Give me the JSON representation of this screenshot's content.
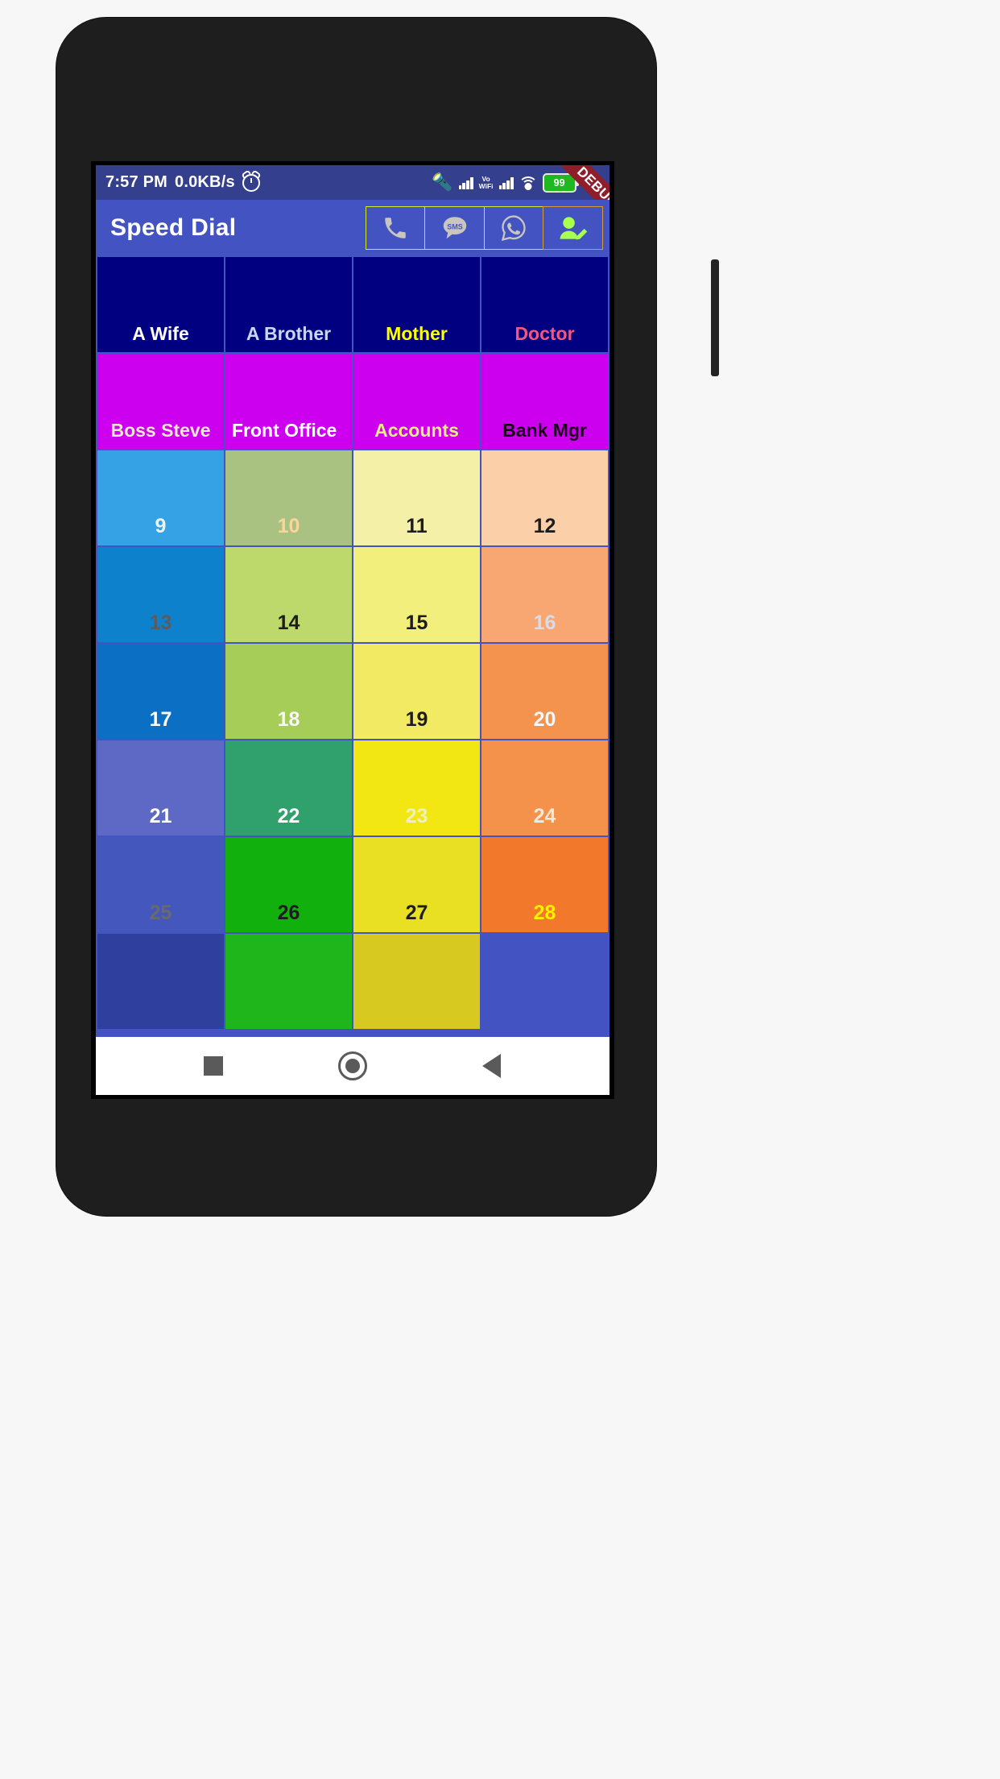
{
  "status_bar": {
    "time": "7:57 PM",
    "network_speed": "0.0KB/s",
    "alarm_icon": "alarm-clock-icon",
    "bluetooth_icon": "bluetooth-icon",
    "signal_icon_1": "cellular-signal-icon",
    "volte_line1": "Vo",
    "volte_line2": "WiFi",
    "signal_icon_2": "cellular-signal-icon",
    "wifi_icon": "wifi-icon",
    "battery_percent": "99",
    "charging_icon": "charging-bolt-icon",
    "background": "#343f8d"
  },
  "debug_ribbon": {
    "label": "DEBUG",
    "color": "#8f1d2a"
  },
  "app_bar": {
    "title": "Speed Dial",
    "background": "#4354c2",
    "actions": [
      {
        "name": "call-button",
        "icon": "phone-icon",
        "border": "#d7e830"
      },
      {
        "name": "sms-button",
        "icon": "sms-icon",
        "border": "#d7e830",
        "glyph_text": "SMS"
      },
      {
        "name": "whatsapp-button",
        "icon": "whatsapp-icon",
        "border": "#d7e830"
      },
      {
        "name": "add-contact-button",
        "icon": "add-contact-icon",
        "border": "#d89a3a"
      }
    ]
  },
  "grid": {
    "background": "#4354c2",
    "tiles": [
      {
        "label": "A Wife",
        "bg": "#000080",
        "fg": "#ffffff",
        "align": "center"
      },
      {
        "label": "A Brother",
        "bg": "#000080",
        "fg": "#c5d9f5",
        "align": "center"
      },
      {
        "label": "Mother",
        "bg": "#000080",
        "fg": "#ffff00",
        "align": "center"
      },
      {
        "label": "Doctor",
        "bg": "#000080",
        "fg": "#f4567f",
        "align": "center"
      },
      {
        "label": "Boss Steve",
        "bg": "#cc00ee",
        "fg": "#ece6d0",
        "align": "center"
      },
      {
        "label": "Front Office",
        "bg": "#cc00ee",
        "fg": "#ffffff",
        "align": "left"
      },
      {
        "label": "Accounts",
        "bg": "#cc00ee",
        "fg": "#e7f07e",
        "align": "center"
      },
      {
        "label": "Bank Mgr",
        "bg": "#cc00ee",
        "fg": "#1a0018",
        "align": "center"
      },
      {
        "label": "9",
        "bg": "#34a2e4",
        "fg": "#e8f4fb",
        "align": "center"
      },
      {
        "label": "10",
        "bg": "#a9c281",
        "fg": "#fcd59a",
        "align": "center"
      },
      {
        "label": "11",
        "bg": "#f4f0a8",
        "fg": "#1d1d1d",
        "align": "center"
      },
      {
        "label": "12",
        "bg": "#fbd0a9",
        "fg": "#1d1d1d",
        "align": "center"
      },
      {
        "label": "13",
        "bg": "#0e81cc",
        "fg": "#5c5c5c",
        "align": "center"
      },
      {
        "label": "14",
        "bg": "#bed96b",
        "fg": "#1d1d1d",
        "align": "center"
      },
      {
        "label": "15",
        "bg": "#f2ef7d",
        "fg": "#1d1d1d",
        "align": "center"
      },
      {
        "label": "16",
        "bg": "#f9a772",
        "fg": "#d8dce8",
        "align": "center"
      },
      {
        "label": "17",
        "bg": "#0b6fc4",
        "fg": "#ffffff",
        "align": "center"
      },
      {
        "label": "18",
        "bg": "#a5cd57",
        "fg": "#f7f7f7",
        "align": "center"
      },
      {
        "label": "19",
        "bg": "#f2ea63",
        "fg": "#1d1d1d",
        "align": "center"
      },
      {
        "label": "20",
        "bg": "#f4934d",
        "fg": "#f7f7f7",
        "align": "center"
      },
      {
        "label": "21",
        "bg": "#5d69c4",
        "fg": "#ffffff",
        "align": "center"
      },
      {
        "label": "22",
        "bg": "#30a06c",
        "fg": "#ffffff",
        "align": "center"
      },
      {
        "label": "23",
        "bg": "#f2e713",
        "fg": "#f0efc0",
        "align": "center"
      },
      {
        "label": "24",
        "bg": "#f4924c",
        "fg": "#f7e9d8",
        "align": "center"
      },
      {
        "label": "25",
        "bg": "#4457bd",
        "fg": "#6a6a6a",
        "align": "center"
      },
      {
        "label": "26",
        "bg": "#12b00d",
        "fg": "#1d1d1d",
        "align": "center"
      },
      {
        "label": "27",
        "bg": "#e9e024",
        "fg": "#1d1d1d",
        "align": "center"
      },
      {
        "label": "28",
        "bg": "#f2782b",
        "fg": "#ffee00",
        "align": "center"
      },
      {
        "label": "",
        "bg": "#2f3f9e",
        "fg": "#ffffff",
        "align": "center"
      },
      {
        "label": "",
        "bg": "#1fb61b",
        "fg": "#1d1d1d",
        "align": "center"
      },
      {
        "label": "",
        "bg": "#d8c921",
        "fg": "#1d1d1d",
        "align": "center"
      },
      {
        "label": "",
        "bg": "#4354c2",
        "fg": "#ffffff",
        "align": "center"
      }
    ]
  },
  "nav_bar": {
    "background": "#ffffff",
    "buttons": [
      {
        "name": "recents-button",
        "icon": "square-icon"
      },
      {
        "name": "home-button",
        "icon": "circle-icon"
      },
      {
        "name": "back-button",
        "icon": "triangle-back-icon"
      }
    ]
  }
}
